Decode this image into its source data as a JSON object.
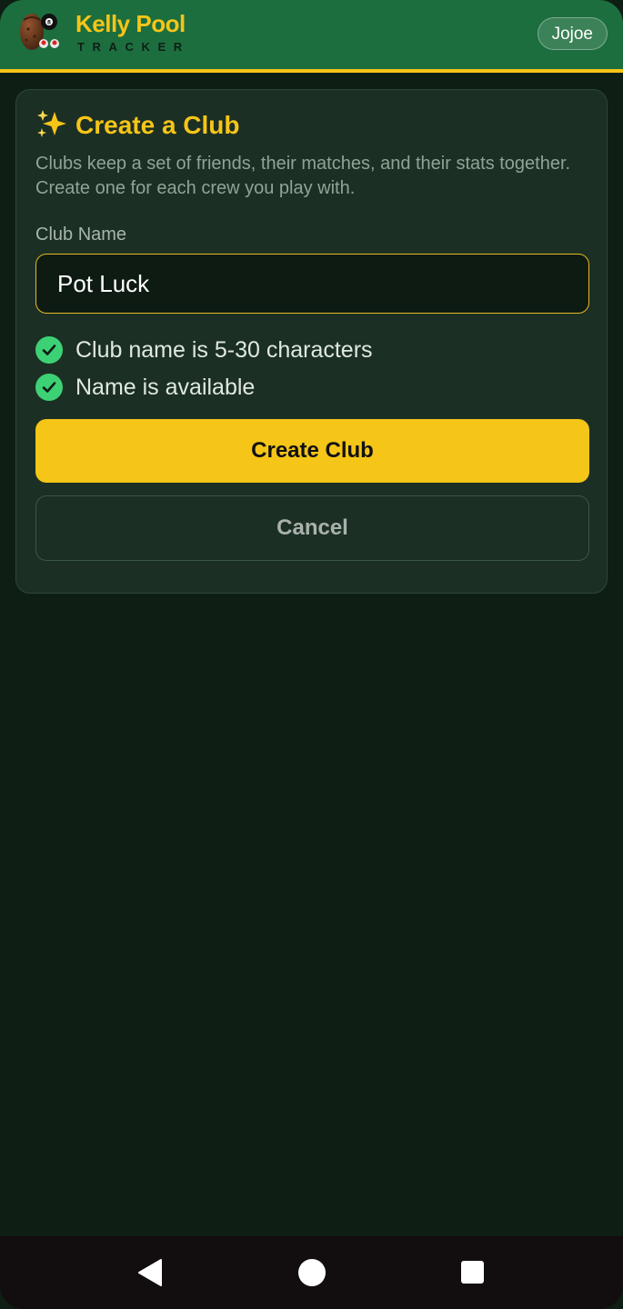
{
  "header": {
    "brand_title": "Kelly Pool",
    "brand_subtitle": "TRACKER",
    "user_name": "Jojoe",
    "logo_icon": "pool-balls-logo-icon"
  },
  "card": {
    "title_icon": "sparkles-icon",
    "title": "Create a Club",
    "description": "Clubs keep a set of friends, their matches, and their stats together. Create one for each crew you play with.",
    "field_label": "Club Name",
    "name_value": "Pot Luck",
    "validations": [
      {
        "icon": "check-circle-icon",
        "text": "Club name is 5-30 characters"
      },
      {
        "icon": "check-circle-icon",
        "text": "Name is available"
      }
    ],
    "create_label": "Create Club",
    "cancel_label": "Cancel"
  },
  "nav": {
    "back_icon": "back-triangle-icon",
    "home_icon": "home-circle-icon",
    "recents_icon": "recents-square-icon"
  },
  "colors": {
    "header_bg": "#1c6e3e",
    "accent": "#f5c518",
    "page_bg": "#0e1e15",
    "card_bg": "#1c2f24",
    "success": "#3dd175"
  }
}
